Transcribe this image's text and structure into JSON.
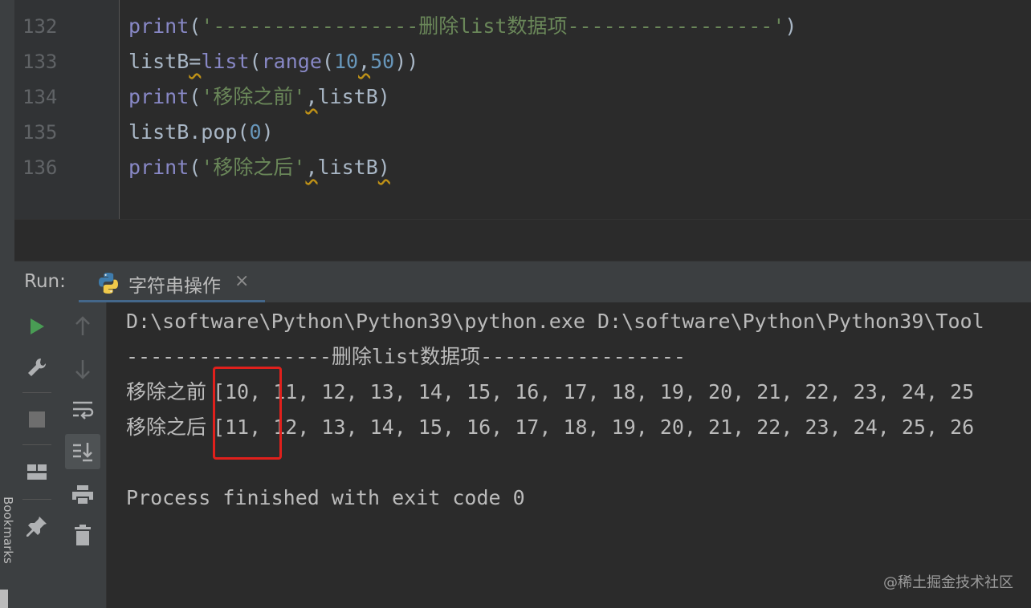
{
  "sidebar": {
    "bookmarks_label": "Bookmarks"
  },
  "editor": {
    "line_numbers": [
      "132",
      "133",
      "134",
      "135",
      "136"
    ],
    "lines": [
      {
        "segments": [
          {
            "t": "print",
            "c": "kw"
          },
          {
            "t": "(",
            "c": ""
          },
          {
            "t": "'-----------------删除list数据项-----------------'",
            "c": "str"
          },
          {
            "t": ")",
            "c": ""
          }
        ]
      },
      {
        "segments": [
          {
            "t": "listB",
            "c": ""
          },
          {
            "t": "=",
            "c": "sq"
          },
          {
            "t": "list",
            "c": "kw"
          },
          {
            "t": "(",
            "c": ""
          },
          {
            "t": "range",
            "c": "kw"
          },
          {
            "t": "(",
            "c": ""
          },
          {
            "t": "10",
            "c": "num"
          },
          {
            "t": ",",
            "c": "sq"
          },
          {
            "t": "50",
            "c": "num"
          },
          {
            "t": "))",
            "c": ""
          }
        ]
      },
      {
        "segments": [
          {
            "t": "print",
            "c": "kw"
          },
          {
            "t": "(",
            "c": ""
          },
          {
            "t": "'移除之前'",
            "c": "str"
          },
          {
            "t": ",",
            "c": "sq"
          },
          {
            "t": "listB)",
            "c": ""
          }
        ]
      },
      {
        "segments": [
          {
            "t": "listB.pop(",
            "c": ""
          },
          {
            "t": "0",
            "c": "num"
          },
          {
            "t": ")",
            "c": ""
          }
        ]
      },
      {
        "segments": [
          {
            "t": "print",
            "c": "kw"
          },
          {
            "t": "(",
            "c": ""
          },
          {
            "t": "'移除之后'",
            "c": "str"
          },
          {
            "t": ",",
            "c": "sq"
          },
          {
            "t": "listB",
            "c": ""
          },
          {
            "t": ")",
            "c": "sq"
          }
        ]
      }
    ]
  },
  "run": {
    "label": "Run:",
    "tab_title": "字符串操作",
    "tab_close": "×"
  },
  "toolbar": {
    "icons": [
      "run-icon",
      "wrench-icon",
      "stop-icon",
      "layout-icon",
      "pin-icon",
      "arrow-up-icon",
      "arrow-down-icon",
      "soft-wrap-icon",
      "scroll-to-end-icon",
      "print-icon",
      "trash-icon"
    ]
  },
  "console": {
    "command": "D:\\software\\Python\\Python39\\python.exe D:\\software\\Python\\Python39\\Tool",
    "header": "-----------------删除list数据项-----------------",
    "before_label": "移除之前 ",
    "before_values": "[10, 11, 12, 13, 14, 15, 16, 17, 18, 19, 20, 21, 22, 23, 24, 25",
    "after_label": "移除之后 ",
    "after_values": "[11, 12, 13, 14, 15, 16, 17, 18, 19, 20, 21, 22, 23, 24, 25, 26",
    "exit_message": "Process finished with exit code 0"
  },
  "watermark": "@稀土掘金技术社区",
  "colors": {
    "highlight_box": "#e0201c",
    "run_green": "#499c54",
    "keyword": "#8888c6",
    "string": "#6a8759",
    "number": "#6897bb"
  }
}
